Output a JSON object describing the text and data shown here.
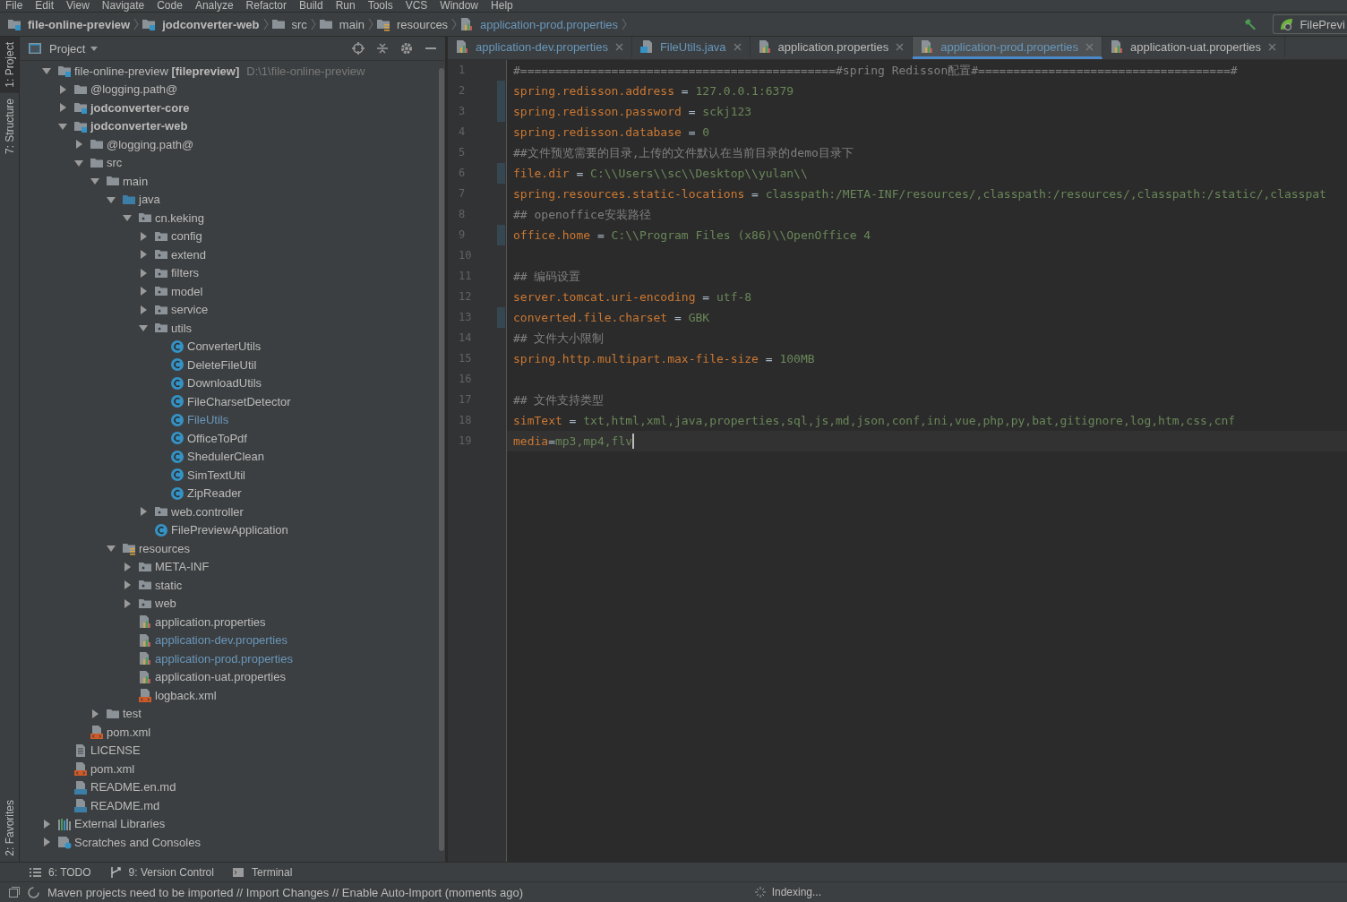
{
  "menu_bar": {
    "items": [
      "File",
      "Edit",
      "View",
      "Navigate",
      "Code",
      "Analyze",
      "Refactor",
      "Build",
      "Run",
      "Tools",
      "VCS",
      "Window",
      "Help"
    ]
  },
  "nav_bar": {
    "breadcrumbs": [
      {
        "label": "file-online-preview",
        "kind": "module",
        "bold": true,
        "modified": false
      },
      {
        "label": "jodconverter-web",
        "kind": "module",
        "bold": true,
        "modified": false
      },
      {
        "label": "src",
        "kind": "folder",
        "bold": false,
        "modified": false
      },
      {
        "label": "main",
        "kind": "folder",
        "bold": false,
        "modified": false
      },
      {
        "label": "resources",
        "kind": "resources",
        "bold": false,
        "modified": false
      },
      {
        "label": "application-prod.properties",
        "kind": "props",
        "bold": false,
        "modified": true
      }
    ],
    "run_config": "FilePrevi"
  },
  "tool_strip": {
    "top": [
      {
        "label": "1: Project",
        "selected": true
      },
      {
        "label": "7: Structure",
        "selected": false
      }
    ],
    "bottom": [
      {
        "label": "2: Favorites",
        "selected": false
      }
    ]
  },
  "project_panel": {
    "title": "Project",
    "tree": [
      {
        "label": "file-online-preview **[filepreview]**",
        "path": "D:\\1\\file-online-preview",
        "kind": "module",
        "expanded": true,
        "children": [
          {
            "label": "@logging.path@",
            "kind": "folder",
            "expanded": false
          },
          {
            "label": "jodconverter-core",
            "kind": "module",
            "bold": true,
            "expanded": false
          },
          {
            "label": "jodconverter-web",
            "kind": "module",
            "bold": true,
            "expanded": true,
            "children": [
              {
                "label": "@logging.path@",
                "kind": "folder",
                "expanded": false
              },
              {
                "label": "src",
                "kind": "folder",
                "expanded": true,
                "children": [
                  {
                    "label": "main",
                    "kind": "folder",
                    "expanded": true,
                    "children": [
                      {
                        "label": "java",
                        "kind": "source",
                        "expanded": true,
                        "children": [
                          {
                            "label": "cn.keking",
                            "kind": "package",
                            "expanded": true,
                            "children": [
                              {
                                "label": "config",
                                "kind": "package",
                                "expanded": false
                              },
                              {
                                "label": "extend",
                                "kind": "package",
                                "expanded": false
                              },
                              {
                                "label": "filters",
                                "kind": "package",
                                "expanded": false
                              },
                              {
                                "label": "model",
                                "kind": "package",
                                "expanded": false
                              },
                              {
                                "label": "service",
                                "kind": "package",
                                "expanded": false
                              },
                              {
                                "label": "utils",
                                "kind": "package",
                                "expanded": true,
                                "children": [
                                  {
                                    "label": "ConverterUtils",
                                    "kind": "class",
                                    "modified": false
                                  },
                                  {
                                    "label": "DeleteFileUtil",
                                    "kind": "class",
                                    "modified": false
                                  },
                                  {
                                    "label": "DownloadUtils",
                                    "kind": "class",
                                    "modified": false
                                  },
                                  {
                                    "label": "FileCharsetDetector",
                                    "kind": "class",
                                    "modified": false
                                  },
                                  {
                                    "label": "FileUtils",
                                    "kind": "class",
                                    "modified": true
                                  },
                                  {
                                    "label": "OfficeToPdf",
                                    "kind": "class",
                                    "modified": false
                                  },
                                  {
                                    "label": "ShedulerClean",
                                    "kind": "class",
                                    "modified": false
                                  },
                                  {
                                    "label": "SimTextUtil",
                                    "kind": "class",
                                    "modified": false
                                  },
                                  {
                                    "label": "ZipReader",
                                    "kind": "class",
                                    "modified": false
                                  }
                                ]
                              },
                              {
                                "label": "web.controller",
                                "kind": "package",
                                "expanded": false
                              },
                              {
                                "label": "FilePreviewApplication",
                                "kind": "class",
                                "modified": false
                              }
                            ]
                          }
                        ]
                      },
                      {
                        "label": "resources",
                        "kind": "resources",
                        "expanded": true,
                        "children": [
                          {
                            "label": "META-INF",
                            "kind": "package",
                            "expanded": false
                          },
                          {
                            "label": "static",
                            "kind": "package",
                            "expanded": false
                          },
                          {
                            "label": "web",
                            "kind": "package",
                            "expanded": false
                          },
                          {
                            "label": "application.properties",
                            "kind": "props",
                            "modified": false
                          },
                          {
                            "label": "application-dev.properties",
                            "kind": "props",
                            "modified": true
                          },
                          {
                            "label": "application-prod.properties",
                            "kind": "props",
                            "modified": true
                          },
                          {
                            "label": "application-uat.properties",
                            "kind": "props",
                            "modified": false
                          },
                          {
                            "label": "logback.xml",
                            "kind": "xml",
                            "modified": false
                          }
                        ]
                      }
                    ]
                  },
                  {
                    "label": "test",
                    "kind": "folder",
                    "expanded": false
                  }
                ]
              },
              {
                "label": "pom.xml",
                "kind": "xml",
                "modified": false
              }
            ]
          },
          {
            "label": "LICENSE",
            "kind": "text",
            "modified": false
          },
          {
            "label": "pom.xml",
            "kind": "xml",
            "modified": false
          },
          {
            "label": "README.en.md",
            "kind": "md",
            "modified": false
          },
          {
            "label": "README.md",
            "kind": "md",
            "modified": false
          }
        ]
      },
      {
        "label": "External Libraries",
        "kind": "libraries",
        "expanded": false
      },
      {
        "label": "Scratches and Consoles",
        "kind": "scratches",
        "expanded": false
      }
    ]
  },
  "editor": {
    "tabs": [
      {
        "label": "application-dev.properties",
        "kind": "props",
        "modified": true,
        "selected": false
      },
      {
        "label": "FileUtils.java",
        "kind": "java",
        "modified": true,
        "selected": false
      },
      {
        "label": "application.properties",
        "kind": "props",
        "modified": false,
        "selected": false
      },
      {
        "label": "application-prod.properties",
        "kind": "props",
        "modified": true,
        "selected": true
      },
      {
        "label": "application-uat.properties",
        "kind": "props",
        "modified": false,
        "selected": false
      }
    ],
    "lines": [
      {
        "number": "1",
        "changed": false,
        "current": false,
        "segments": [
          {
            "kind": "comment",
            "text": "#=============================================#spring Redisson配置#====================================#"
          }
        ]
      },
      {
        "number": "2",
        "changed": true,
        "current": false,
        "segments": [
          {
            "kind": "key",
            "text": "spring.redisson.address"
          },
          {
            "kind": "sep",
            "text": " = "
          },
          {
            "kind": "value",
            "text": "127.0.0.1:6379"
          }
        ]
      },
      {
        "number": "3",
        "changed": true,
        "current": false,
        "segments": [
          {
            "kind": "key",
            "text": "spring.redisson.password"
          },
          {
            "kind": "sep",
            "text": " = "
          },
          {
            "kind": "value",
            "text": "sckj123"
          }
        ]
      },
      {
        "number": "4",
        "changed": false,
        "current": false,
        "segments": [
          {
            "kind": "key",
            "text": "spring.redisson.database"
          },
          {
            "kind": "sep",
            "text": " = "
          },
          {
            "kind": "value",
            "text": "0"
          }
        ]
      },
      {
        "number": "5",
        "changed": false,
        "current": false,
        "segments": [
          {
            "kind": "comment",
            "text": "##文件预览需要的目录,上传的文件默认在当前目录的demo目录下"
          }
        ]
      },
      {
        "number": "6",
        "changed": true,
        "current": false,
        "segments": [
          {
            "kind": "key",
            "text": "file.dir"
          },
          {
            "kind": "sep",
            "text": " = "
          },
          {
            "kind": "value",
            "text": "C:\\\\Users\\\\sc\\\\Desktop\\\\yulan\\\\"
          }
        ]
      },
      {
        "number": "7",
        "changed": false,
        "current": false,
        "segments": [
          {
            "kind": "key",
            "text": "spring.resources.static-locations"
          },
          {
            "kind": "sep",
            "text": " = "
          },
          {
            "kind": "value",
            "text": "classpath:/META-INF/resources/,classpath:/resources/,classpath:/static/,classpat"
          }
        ]
      },
      {
        "number": "8",
        "changed": false,
        "current": false,
        "segments": [
          {
            "kind": "comment",
            "text": "## openoffice安装路径"
          }
        ]
      },
      {
        "number": "9",
        "changed": true,
        "current": false,
        "segments": [
          {
            "kind": "key",
            "text": "office.home"
          },
          {
            "kind": "sep",
            "text": " = "
          },
          {
            "kind": "value",
            "text": "C:\\\\Program Files (x86)\\\\OpenOffice 4"
          }
        ]
      },
      {
        "number": "10",
        "changed": false,
        "current": false
      },
      {
        "number": "11",
        "changed": false,
        "current": false,
        "segments": [
          {
            "kind": "comment",
            "text": "## 编码设置"
          }
        ]
      },
      {
        "number": "12",
        "changed": false,
        "current": false,
        "segments": [
          {
            "kind": "key",
            "text": "server.tomcat.uri-encoding"
          },
          {
            "kind": "sep",
            "text": " = "
          },
          {
            "kind": "value",
            "text": "utf-8"
          }
        ]
      },
      {
        "number": "13",
        "changed": true,
        "current": false,
        "segments": [
          {
            "kind": "key",
            "text": "converted.file.charset"
          },
          {
            "kind": "sep",
            "text": " = "
          },
          {
            "kind": "value",
            "text": "GBK"
          }
        ]
      },
      {
        "number": "14",
        "changed": false,
        "current": false,
        "segments": [
          {
            "kind": "comment",
            "text": "## 文件大小限制"
          }
        ]
      },
      {
        "number": "15",
        "changed": false,
        "current": false,
        "segments": [
          {
            "kind": "key",
            "text": "spring.http.multipart.max-file-size"
          },
          {
            "kind": "sep",
            "text": " = "
          },
          {
            "kind": "value",
            "text": "100MB"
          }
        ]
      },
      {
        "number": "16",
        "changed": false,
        "current": false
      },
      {
        "number": "17",
        "changed": false,
        "current": false,
        "segments": [
          {
            "kind": "comment",
            "text": "## 文件支持类型"
          }
        ]
      },
      {
        "number": "18",
        "changed": false,
        "current": false,
        "segments": [
          {
            "kind": "key",
            "text": "simText"
          },
          {
            "kind": "sep",
            "text": " = "
          },
          {
            "kind": "value",
            "text": "txt,html,xml,java,properties,sql,js,md,json,conf,ini,vue,php,py,bat,gitignore,log,htm,css,cnf"
          }
        ]
      },
      {
        "number": "19",
        "changed": false,
        "current": true,
        "segments": [
          {
            "kind": "key",
            "text": "media"
          },
          {
            "kind": "sep",
            "text": "="
          },
          {
            "kind": "value",
            "text": "mp3,mp4,flv"
          }
        ]
      }
    ]
  },
  "tool_buttons": [
    {
      "label": "6: TODO",
      "kind": "list"
    },
    {
      "label": "9: Version Control",
      "kind": "vcs"
    },
    {
      "label": "Terminal",
      "kind": "terminal"
    }
  ],
  "status_bar": {
    "message": "Maven projects need to be imported // Import Changes // Enable Auto-Import (moments ago)",
    "progress": "Indexing..."
  }
}
